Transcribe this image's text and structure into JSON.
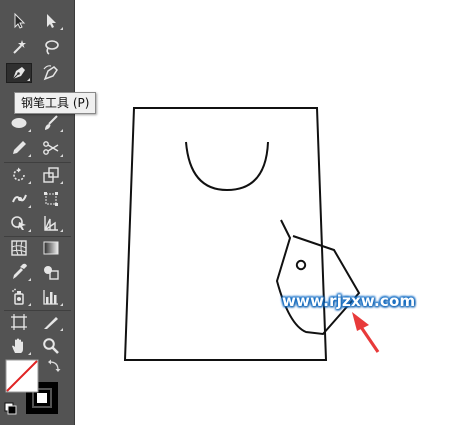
{
  "tooltip": {
    "text": "钢笔工具 (P)"
  },
  "watermark": {
    "text": "www.rjzxw.com"
  },
  "colors": {
    "panel": "#535353",
    "canvas": "#ffffff",
    "arrow": "#e83a3a",
    "watermark": "#1a73c9"
  },
  "tools": [
    [
      "selection-tool-icon",
      "direct-selection-tool-icon"
    ],
    [
      "magic-wand-tool-icon",
      "lasso-tool-icon"
    ],
    [
      "pen-tool-icon",
      "curvature-tool-icon"
    ],
    [
      "type-tool-icon",
      "line-segment-tool-icon"
    ],
    [
      "ellipse-tool-icon",
      "paintbrush-tool-icon"
    ],
    [
      "pencil-tool-icon",
      "scissors-tool-icon"
    ],
    [
      "rotate-tool-icon",
      "scale-tool-icon"
    ],
    [
      "puppet-warp-tool-icon",
      "free-transform-tool-icon"
    ],
    [
      "shape-builder-tool-icon",
      "perspective-grid-tool-icon"
    ],
    [
      "mesh-tool-icon",
      "gradient-tool-icon"
    ],
    [
      "eyedropper-tool-icon",
      "blend-tool-icon"
    ],
    [
      "symbol-sprayer-tool-icon",
      "column-graph-tool-icon"
    ],
    [
      "artboard-tool-icon",
      "slice-tool-icon"
    ],
    [
      "hand-tool-icon",
      "zoom-tool-icon"
    ]
  ]
}
